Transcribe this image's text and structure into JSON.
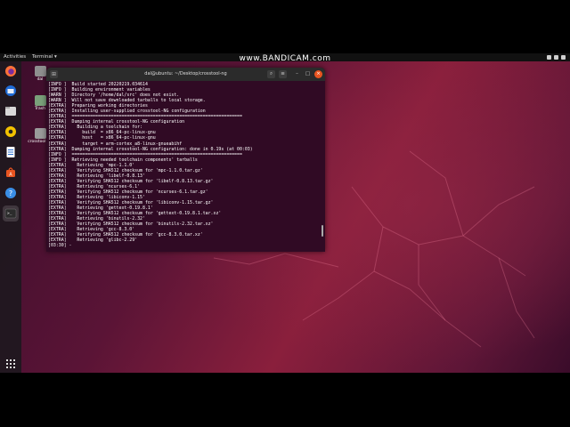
{
  "watermark": "www.BANDICAM.com",
  "topbar": {
    "activities": "Activities",
    "app_menu": "Terminal ▾"
  },
  "desktop": {
    "icons": [
      {
        "label": "dal"
      },
      {
        "label": "Trash"
      },
      {
        "label": "crosstool-ng"
      }
    ]
  },
  "dock": {
    "items": [
      "firefox-icon",
      "thunderbird-icon",
      "files-icon",
      "rhythmbox-icon",
      "libreoffice-writer-icon",
      "software-icon",
      "help-icon",
      "terminal-icon",
      "show-applications-icon"
    ]
  },
  "terminal": {
    "title": "dal@ubuntu: ~/Desktop/crosstool-ng",
    "lines": [
      "[INFO ]  Build started 20220219.034614",
      "[INFO ]  Building environment variables",
      "[WARN ]  Directory '/home/dal/src' does not exist.",
      "[WARN ]  Will not save downloaded tarballs to local storage.",
      "[EXTRA]  Preparing working directories",
      "[EXTRA]  Installing user-supplied crosstool-NG configuration",
      "[EXTRA]  =================================================================",
      "[EXTRA]  Dumping internal crosstool-NG configuration",
      "[EXTRA]    Building a toolchain for:",
      "[EXTRA]      build  = x86_64-pc-linux-gnu",
      "[EXTRA]      host   = x86_64-pc-linux-gnu",
      "[EXTRA]      target = arm-cortex_a8-linux-gnueabihf",
      "[EXTRA]  Dumping internal crosstool-NG configuration: done in 0.19s (at 00:03)",
      "[INFO ]  =================================================================",
      "[INFO ]  Retrieving needed toolchain components' tarballs",
      "[EXTRA]    Retrieving 'mpc-1.1.0'",
      "[EXTRA]    Verifying SHA512 checksum for 'mpc-1.1.0.tar.gz'",
      "[EXTRA]    Retrieving 'libelf-0.8.13'",
      "[EXTRA]    Verifying SHA512 checksum for 'libelf-0.8.13.tar.gz'",
      "[EXTRA]    Retrieving 'ncurses-6.1'",
      "[EXTRA]    Verifying SHA512 checksum for 'ncurses-6.1.tar.gz'",
      "[EXTRA]    Retrieving 'libiconv-1.15'",
      "[EXTRA]    Verifying SHA512 checksum for 'libiconv-1.15.tar.gz'",
      "[EXTRA]    Retrieving 'gettext-0.19.8.1'",
      "[EXTRA]    Verifying SHA512 checksum for 'gettext-0.19.8.1.tar.xz'",
      "[EXTRA]    Retrieving 'binutils-2.32'",
      "[EXTRA]    Verifying SHA512 checksum for 'binutils-2.32.tar.xz'",
      "[EXTRA]    Retrieving 'gcc-8.3.0'",
      "[EXTRA]    Verifying SHA512 checksum for 'gcc-8.3.0.tar.xz'",
      "[EXTRA]    Retrieving 'glibc-2.29'",
      "[03:30] -"
    ]
  },
  "colors": {
    "terminal_bg": "#300a24",
    "accent": "#e95420",
    "header_bg": "#2b2b2b"
  }
}
